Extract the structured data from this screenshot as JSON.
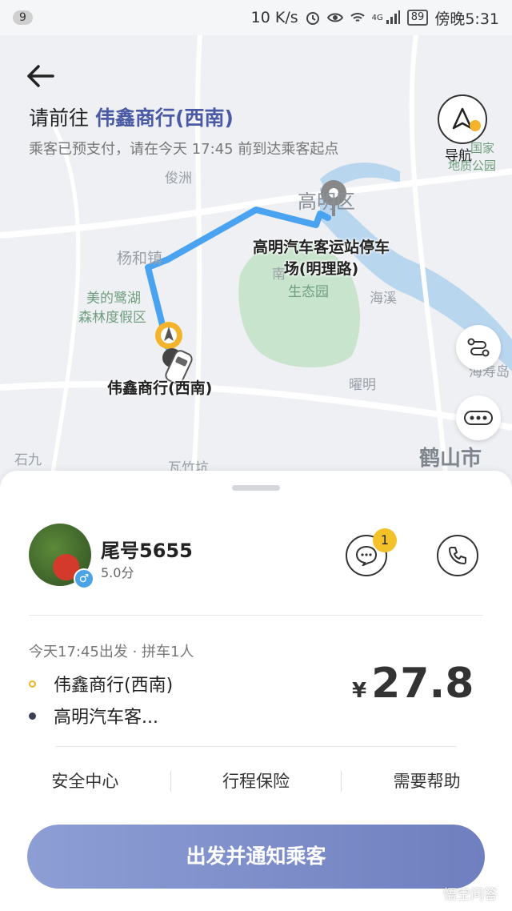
{
  "status_bar": {
    "notification_count": "9",
    "network_speed": "10 K/s",
    "signal_label": "4G",
    "battery": "89",
    "time": "傍晚5:31"
  },
  "header": {
    "prefix": "请前往",
    "destination": "伟鑫商行(西南)",
    "subtitle": "乘客已预支付，请在今天 17:45 前到达乘客起点",
    "nav_label": "导航"
  },
  "map": {
    "labels": [
      "俊洲",
      "高明区",
      "杨和镇",
      "美的鹭湖",
      "森林度假区",
      "生态园",
      "海溪",
      "曜明",
      "石九",
      "瓦竹坑",
      "鹤山市",
      "南",
      "海寿岛",
      "国家",
      "地质公园"
    ],
    "pickup_label": "伟鑫商行(西南)",
    "dropoff_label_line1": "高明汽车客运站停车",
    "dropoff_label_line2": "场(明理路)",
    "route_color": "#4aa3f0"
  },
  "passenger": {
    "name": "尾号5655",
    "rating": "5.0分",
    "gender_symbol": "♂",
    "unread_messages": "1"
  },
  "trip": {
    "meta": "今天17:45出发 · 拼车1人",
    "pickup": "伟鑫商行(西南)",
    "dropoff": "高明汽车客...",
    "currency": "¥",
    "price": "27.8"
  },
  "footer": {
    "safety": "安全中心",
    "insurance": "行程保险",
    "help": "需要帮助"
  },
  "cta": {
    "label": "出发并通知乘客"
  },
  "watermark": "悟空问答",
  "colors": {
    "accent": "#4a5aa5",
    "pickup_dot": "#f3b32a",
    "cta": "#7f8fca"
  }
}
